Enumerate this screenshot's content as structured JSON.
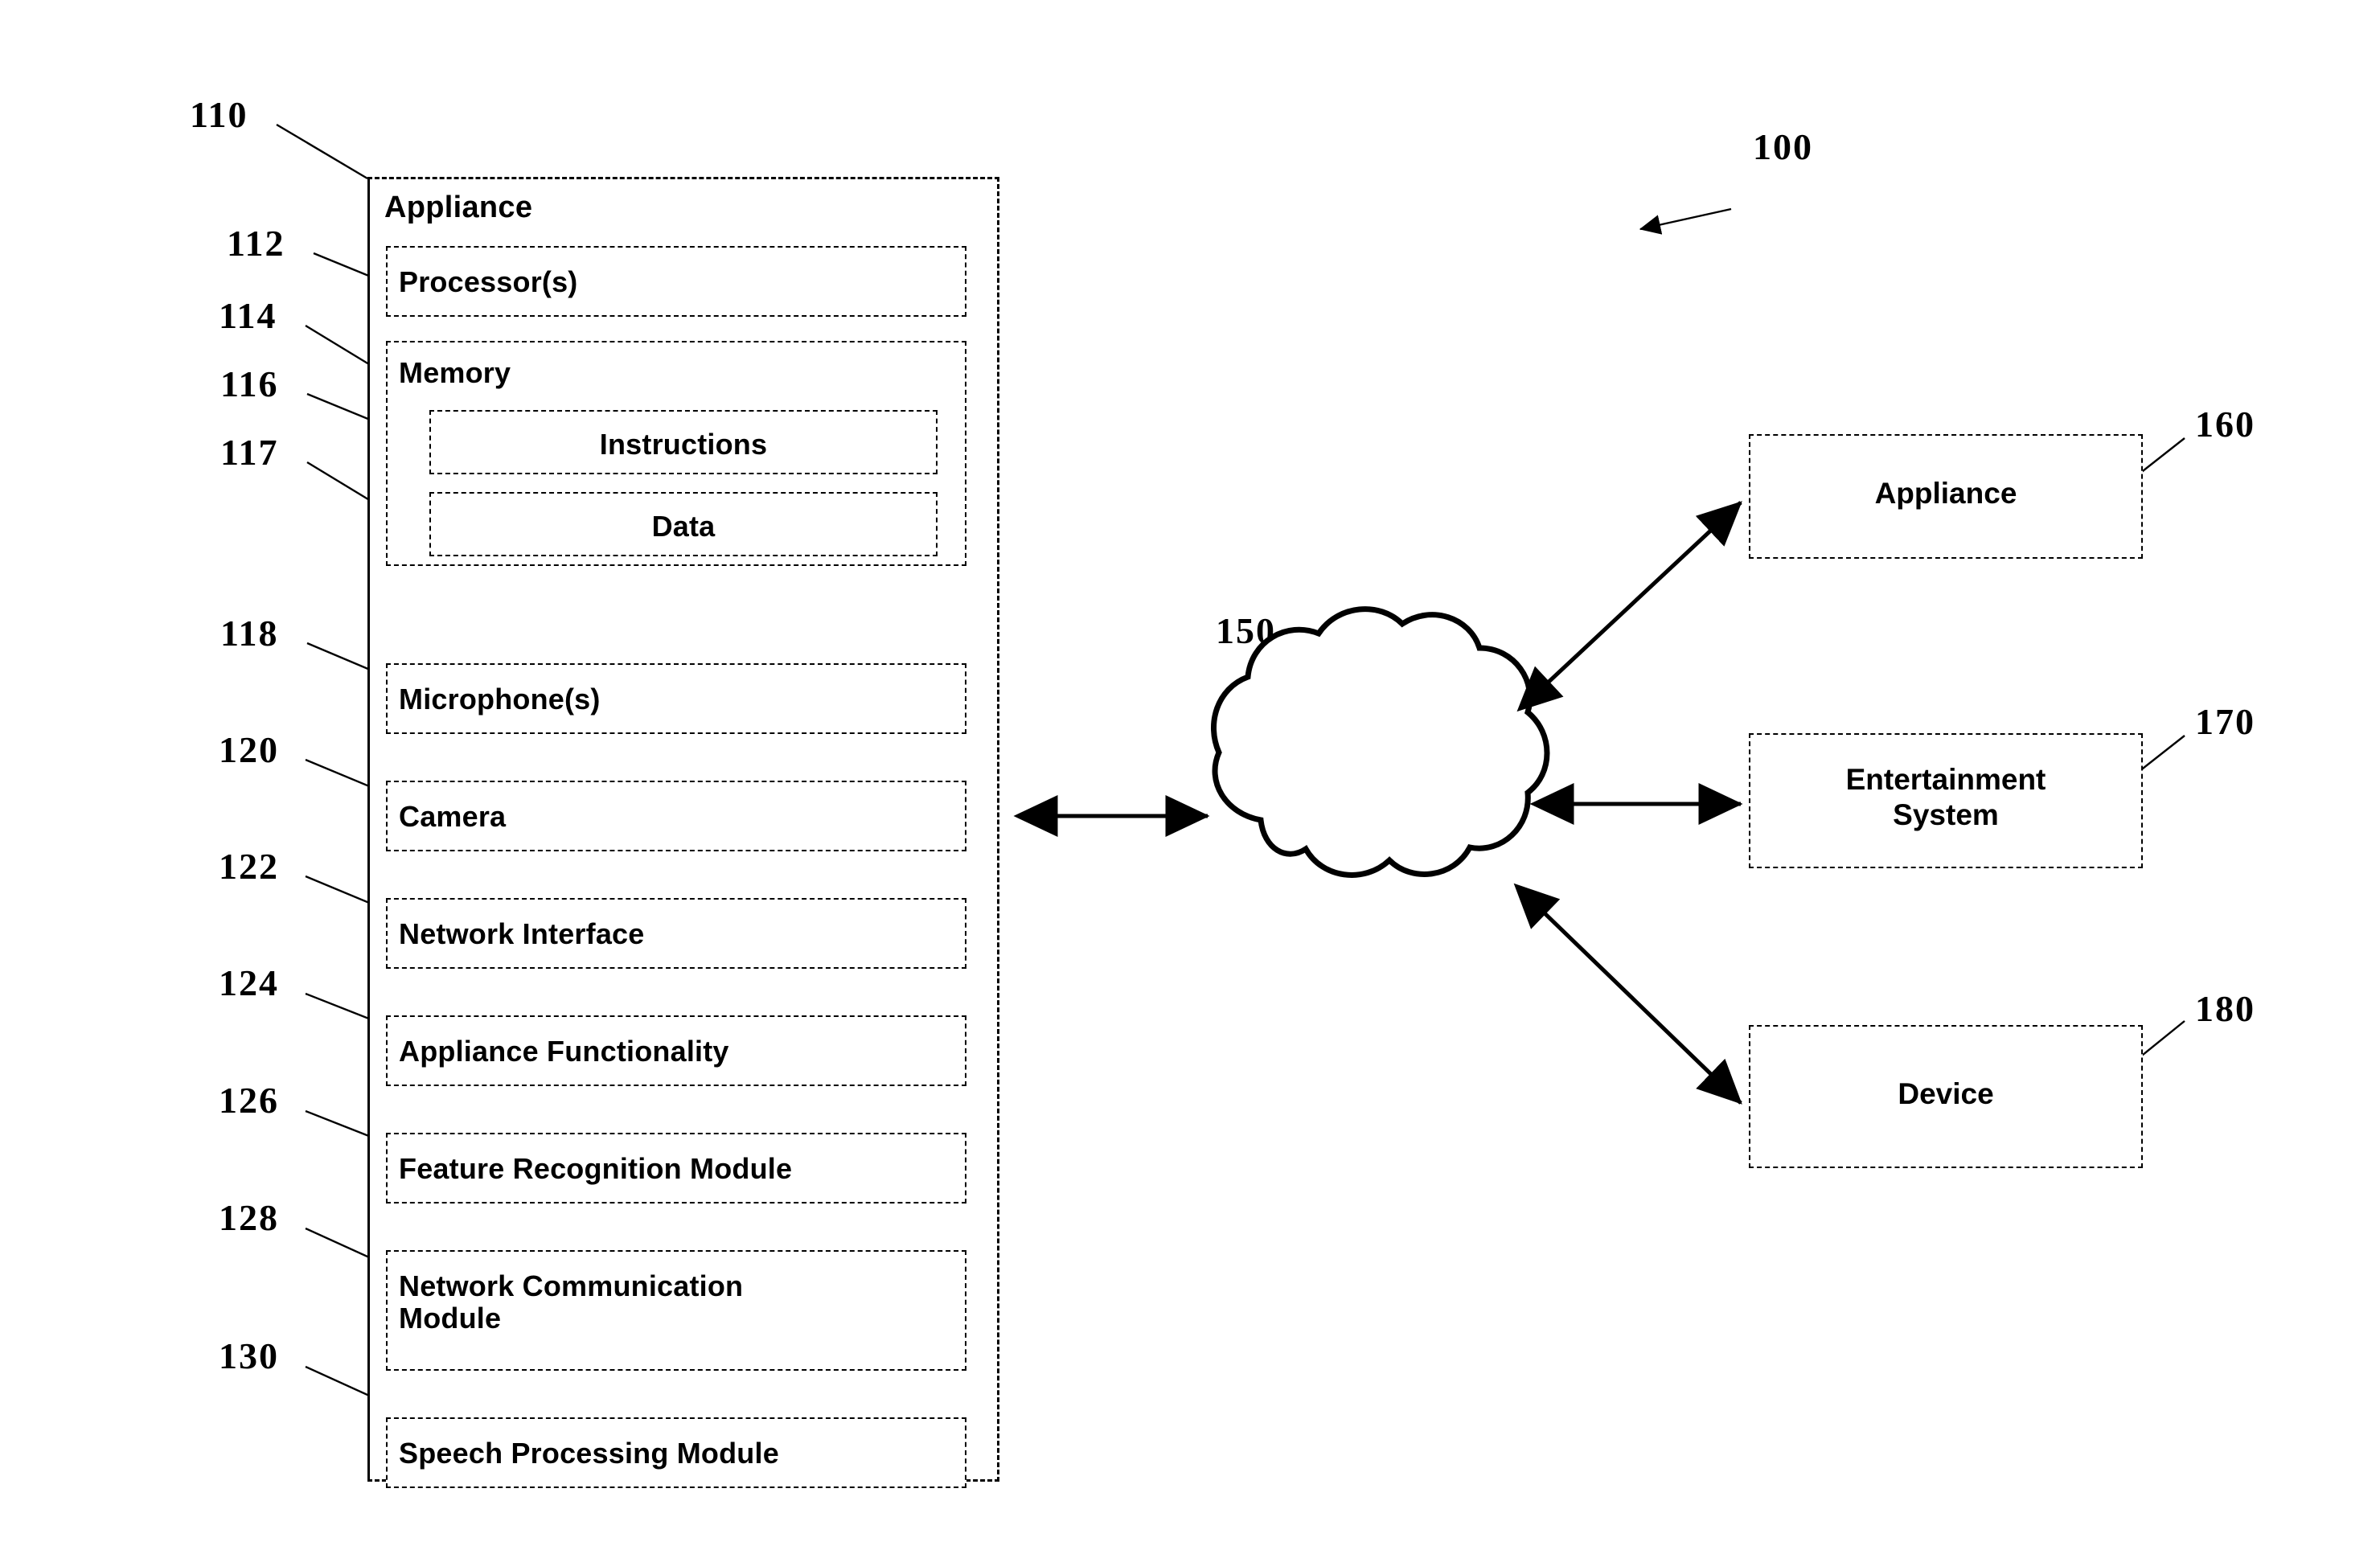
{
  "figure": {
    "system_ref": "100"
  },
  "appliance": {
    "ref": "110",
    "title": "Appliance",
    "components": [
      {
        "ref": "112",
        "label": "Processor(s)",
        "align": "left"
      },
      {
        "ref": "114",
        "label": "Memory",
        "align": "left"
      },
      {
        "ref": "118",
        "label": "Microphone(s)",
        "align": "left"
      },
      {
        "ref": "120",
        "label": "Camera",
        "align": "left"
      },
      {
        "ref": "122",
        "label": "Network Interface",
        "align": "left"
      },
      {
        "ref": "124",
        "label": "Appliance Functionality",
        "align": "left"
      },
      {
        "ref": "126",
        "label": "Feature Recognition Module",
        "align": "left"
      },
      {
        "ref": "128",
        "label": "Network Communication\nModule",
        "align": "left"
      },
      {
        "ref": "130",
        "label": "Speech Processing Module",
        "align": "left"
      }
    ],
    "memory_contents": [
      {
        "ref": "116",
        "label": "Instructions"
      },
      {
        "ref": "117",
        "label": "Data"
      }
    ]
  },
  "network": {
    "ref": "150",
    "label": ""
  },
  "endpoints": [
    {
      "ref": "160",
      "label": "Appliance"
    },
    {
      "ref": "170",
      "label": "Entertainment\nSystem"
    },
    {
      "ref": "180",
      "label": "Device"
    }
  ],
  "colors": {
    "ink": "#000000",
    "paper": "#ffffff"
  }
}
